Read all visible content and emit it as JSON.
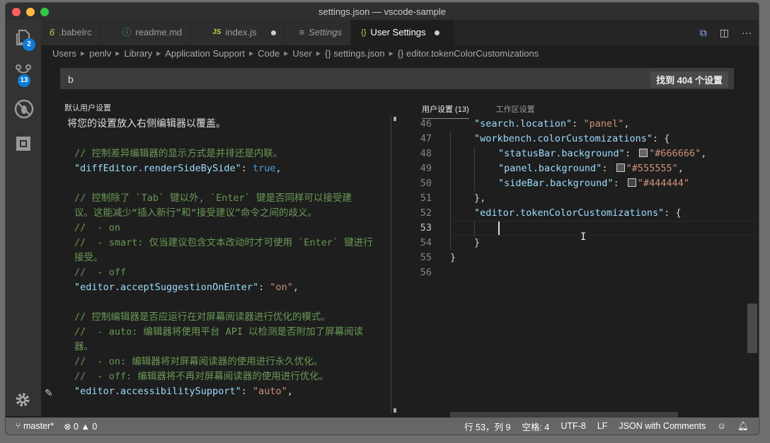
{
  "window": {
    "title": "settings.json — vscode-sample"
  },
  "activity_bar": {
    "explorer_badge": "2",
    "scm_badge": "13"
  },
  "tabs": [
    {
      "label": ".babelrc",
      "icon": "6",
      "dirty": false,
      "active": false
    },
    {
      "label": "readme.md",
      "icon": "ⓘ",
      "dirty": false,
      "active": false
    },
    {
      "label": "index.js",
      "icon": "JS",
      "dirty": true,
      "active": false
    },
    {
      "label": "Settings",
      "icon": "≡",
      "dirty": false,
      "active": false
    },
    {
      "label": "User Settings",
      "icon": "{}",
      "dirty": true,
      "active": true
    }
  ],
  "tab_actions": {
    "open_json": "⧉",
    "split": "◫",
    "more": "···"
  },
  "breadcrumb": [
    "Users",
    "penlv",
    "Library",
    "Application Support",
    "Code",
    "User",
    "{} settings.json",
    "{} editor.tokenColorCustomizations"
  ],
  "search": {
    "value": "b",
    "result_count": "找到 404 个设置"
  },
  "left_pane": {
    "title": "默认用户设置",
    "description": "将您的设置放入右侧编辑器以覆盖。",
    "lines": [
      {
        "type": "comment",
        "text": "// 控制差异编辑器的显示方式是并排还是内联。"
      },
      {
        "type": "kv",
        "key": "\"diffEditor.renderSideBySide\"",
        "value": "true",
        "vtype": "kw"
      },
      {
        "type": "blank",
        "text": ""
      },
      {
        "type": "comment",
        "text": "// 控制除了 `Tab` 键以外, `Enter` 键是否同样可以接受建"
      },
      {
        "type": "comment",
        "text": "议。这能减少“插入新行”和“接受建议”命令之间的歧义。"
      },
      {
        "type": "comment",
        "text": "//  - on"
      },
      {
        "type": "comment",
        "text": "//  - smart: 仅当建议包含文本改动时才可使用 `Enter` 键进行"
      },
      {
        "type": "comment",
        "text": "接受。"
      },
      {
        "type": "comment",
        "text": "//  - off"
      },
      {
        "type": "kv",
        "key": "\"editor.acceptSuggestionOnEnter\"",
        "value": "\"on\"",
        "vtype": "str"
      },
      {
        "type": "blank",
        "text": ""
      },
      {
        "type": "comment",
        "text": "// 控制编辑器是否应运行在对屏幕阅读器进行优化的模式。"
      },
      {
        "type": "comment",
        "text": "//  - auto: 编辑器将使用平台 API 以检测是否附加了屏幕阅读"
      },
      {
        "type": "comment",
        "text": "器。"
      },
      {
        "type": "comment",
        "text": "//  - on: 编辑器将对屏幕阅读器的使用进行永久优化。"
      },
      {
        "type": "comment",
        "text": "//  - off: 编辑器将不再对屏幕阅读器的使用进行优化。"
      },
      {
        "type": "kv",
        "key": "\"editor.accessibilitySupport\"",
        "value": "\"auto\"",
        "vtype": "str"
      }
    ]
  },
  "right_pane": {
    "tabs": [
      "用户设置 (13)",
      "工作区设置"
    ],
    "lines": [
      {
        "n": "46",
        "indent": 1,
        "key": "\"search.location\"",
        "value": "\"panel\"",
        "tail": ","
      },
      {
        "n": "47",
        "indent": 1,
        "key": "\"workbench.colorCustomizations\"",
        "value": "",
        "tail": "{"
      },
      {
        "n": "48",
        "indent": 2,
        "key": "\"statusBar.background\"",
        "value": "\"#666666\"",
        "tail": ",",
        "swatch": "#666666"
      },
      {
        "n": "49",
        "indent": 2,
        "key": "\"panel.background\"",
        "value": "\"#555555\"",
        "tail": ",",
        "swatch": "#555555"
      },
      {
        "n": "50",
        "indent": 2,
        "key": "\"sideBar.background\"",
        "value": "\"#444444\"",
        "tail": "",
        "swatch": "#444444"
      },
      {
        "n": "51",
        "indent": 1,
        "key": "",
        "value": "",
        "tail": "},"
      },
      {
        "n": "52",
        "indent": 1,
        "key": "\"editor.tokenColorCustomizations\"",
        "value": "",
        "tail": "{"
      },
      {
        "n": "53",
        "indent": 2,
        "key": "",
        "value": "",
        "tail": "",
        "current": true
      },
      {
        "n": "54",
        "indent": 1,
        "key": "",
        "value": "",
        "tail": "}"
      },
      {
        "n": "55",
        "indent": 0,
        "key": "",
        "value": "",
        "tail": "}"
      },
      {
        "n": "56",
        "indent": 0,
        "key": "",
        "value": "",
        "tail": ""
      }
    ]
  },
  "status_bar": {
    "branch": "master*",
    "errors": "0",
    "warnings": "0",
    "position": "行 53，列 9",
    "indent": "空格: 4",
    "encoding": "UTF-8",
    "eol": "LF",
    "language": "JSON with Comments"
  },
  "colors": {
    "status_bar": "#666666",
    "badge": "#0e7bd8",
    "comment": "#6a9955",
    "key": "#9cdcfe",
    "string": "#ce9178",
    "keyword": "#569cd6"
  }
}
